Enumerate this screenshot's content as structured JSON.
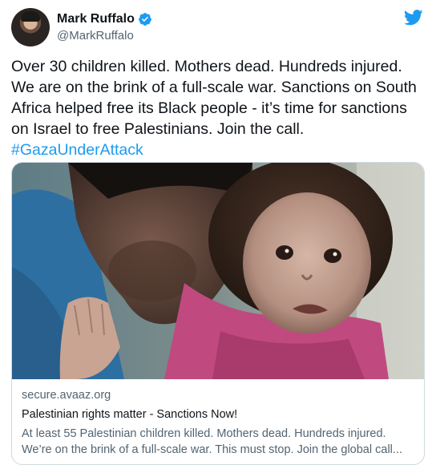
{
  "author": {
    "name": "Mark Ruffalo",
    "handle": "@MarkRuffalo",
    "verified": true
  },
  "tweet": {
    "lines": [
      "Over 30 children killed. Mothers dead. Hundreds injured.",
      "We are on the brink of a full-scale war. Sanctions on South",
      "Africa helped free its Black people - it’s time for sanctions",
      "on Israel to free Palestinians. Join the call."
    ],
    "hashtag": "#GazaUnderAttack"
  },
  "link_card": {
    "domain": "secure.avaaz.org",
    "title": "Palestinian rights matter - Sanctions Now!",
    "description_lines": [
      "At least 55 Palestinian children killed. Mothers dead. Hundreds injured.",
      "We’re on the brink of a full-scale war. This must stop. Join the global call..."
    ],
    "image": "man-holding-injured-child-photo"
  },
  "icons": {
    "verified": "verified-badge-icon",
    "logo": "twitter-bird-icon"
  },
  "colors": {
    "link_blue": "#1d9bf0",
    "text": "#0f1419",
    "secondary_text": "#536471",
    "border": "#cfd9de"
  }
}
